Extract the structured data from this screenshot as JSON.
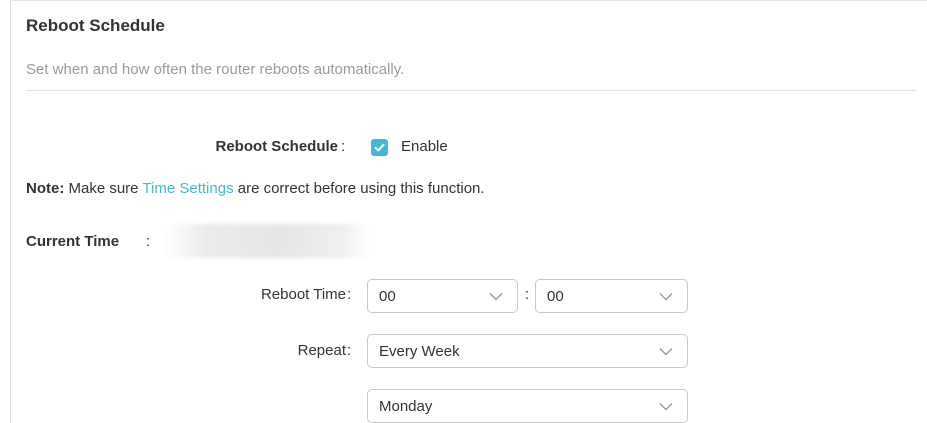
{
  "section": {
    "title": "Reboot Schedule",
    "description": "Set when and how often the router reboots automatically."
  },
  "reboot_schedule": {
    "label": "Reboot Schedule",
    "colon": ":",
    "enabled": true,
    "enable_label": "Enable"
  },
  "note": {
    "prefix": "Note:",
    "text_before_link": " Make sure ",
    "link_text": "Time Settings",
    "text_after_link": " are correct before using this function."
  },
  "current_time": {
    "label": "Current Time",
    "colon": ":"
  },
  "reboot_time": {
    "label": "Reboot Time",
    "colon": ":",
    "hour": "00",
    "separator": ":",
    "minute": "00"
  },
  "repeat": {
    "label": "Repeat",
    "colon": ":",
    "frequency": "Every Week",
    "day": "Monday"
  },
  "colors": {
    "accent": "#45b8d1",
    "text": "#333333",
    "muted": "#9a9a9a",
    "border": "#c8c8c8"
  },
  "icons": {
    "checkbox": "check-icon",
    "dropdown": "chevron-down-icon"
  }
}
